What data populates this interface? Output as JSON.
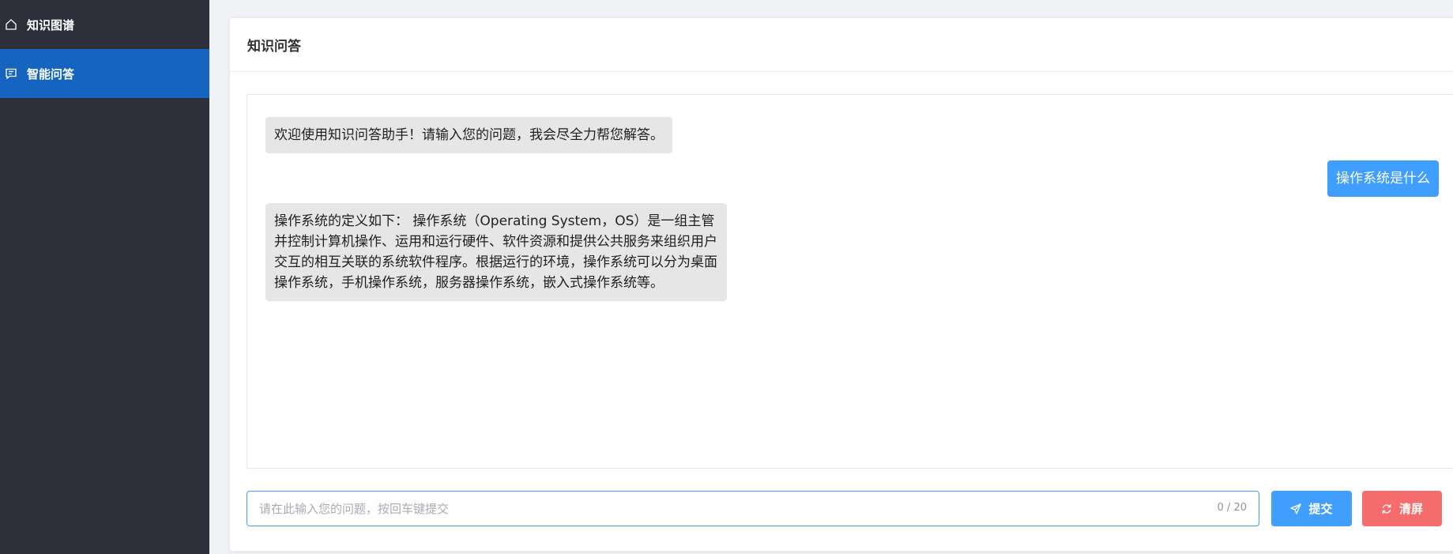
{
  "sidebar": {
    "items": [
      {
        "label": "知识图谱",
        "icon": "home-icon",
        "active": false
      },
      {
        "label": "智能问答",
        "icon": "chat-icon",
        "active": true
      }
    ],
    "colors": {
      "background": "#2d2f3a",
      "active": "#1565c0"
    }
  },
  "page": {
    "title": "知识问答"
  },
  "chat": {
    "messages": [
      {
        "role": "bot",
        "text": "欢迎使用知识问答助手！请输入您的问题，我会尽全力帮您解答。"
      },
      {
        "role": "user",
        "text": "操作系统是什么"
      },
      {
        "role": "bot",
        "text": "操作系统的定义如下： 操作系统（Operating System，OS）是一组主管并控制计算机操作、运用和运行硬件、软件资源和提供公共服务来组织用户交互的相互关联的系统软件程序。根据运行的环境，操作系统可以分为桌面操作系统，手机操作系统，服务器操作系统，嵌入式操作系统等。"
      }
    ]
  },
  "composer": {
    "placeholder": "请在此输入您的问题，按回车键提交",
    "value": "",
    "counter": "0 / 20",
    "submit_label": "提交",
    "submit_icon": "send-icon",
    "clear_label": "清屏",
    "clear_icon": "refresh-icon",
    "colors": {
      "submit": "#409eff",
      "clear": "#f56c6c"
    }
  }
}
